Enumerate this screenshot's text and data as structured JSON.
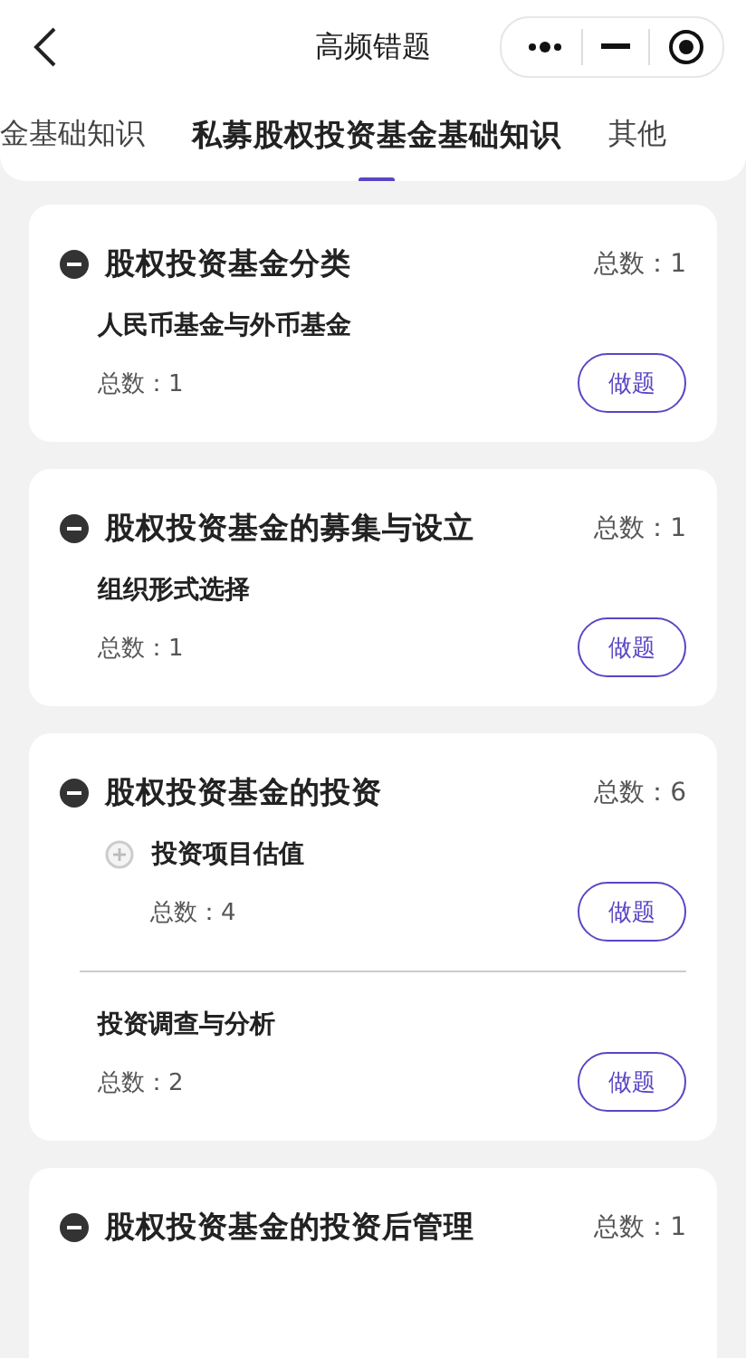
{
  "header": {
    "title": "高频错题"
  },
  "tabs": [
    {
      "label": "金基础知识",
      "selected": false
    },
    {
      "label": "私募股权投资基金基础知识",
      "selected": true
    },
    {
      "label": "其他",
      "selected": false
    }
  ],
  "sections": [
    {
      "title": "股权投资基金分类",
      "total": "总数：1",
      "expanded": true,
      "items": [
        {
          "kind": "leaf",
          "title": "人民币基金与外币基金",
          "total": "总数：1",
          "button": "做题"
        }
      ]
    },
    {
      "title": "股权投资基金的募集与设立",
      "total": "总数：1",
      "expanded": true,
      "items": [
        {
          "kind": "leaf",
          "title": "组织形式选择",
          "total": "总数：1",
          "button": "做题"
        }
      ]
    },
    {
      "title": "股权投资基金的投资",
      "total": "总数：6",
      "expanded": true,
      "items": [
        {
          "kind": "group",
          "expanded": false,
          "title": "投资项目估值",
          "total": "总数：4",
          "button": "做题"
        },
        {
          "kind": "leaf",
          "title": "投资调查与分析",
          "total": "总数：2",
          "button": "做题"
        }
      ]
    },
    {
      "title": "股权投资基金的投资后管理",
      "total": "总数：1",
      "expanded": true
    }
  ]
}
